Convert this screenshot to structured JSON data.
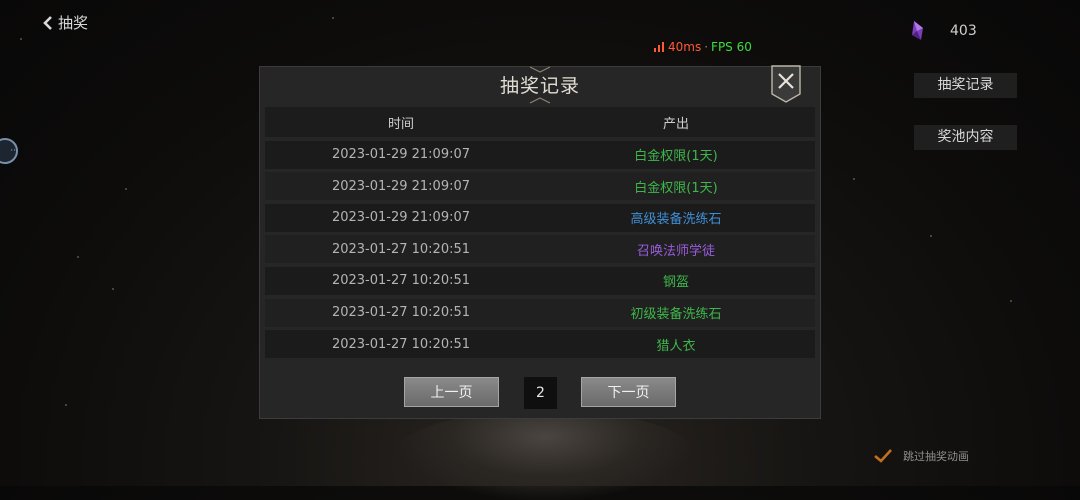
{
  "header": {
    "back_label": "抽奖"
  },
  "network": {
    "ping": "40ms",
    "separator": "·",
    "fps": "FPS 60"
  },
  "currency": {
    "icon": "purple-crystal-icon",
    "amount": "403"
  },
  "side_buttons": {
    "records": "抽奖记录",
    "pool": "奖池内容"
  },
  "modal": {
    "title": "抽奖记录",
    "columns": [
      "时间",
      "产出"
    ],
    "rows": [
      {
        "time": "2023-01-29 21:09:07",
        "item": "白金权限(1天)",
        "color": "#3fb64b"
      },
      {
        "time": "2023-01-29 21:09:07",
        "item": "白金权限(1天)",
        "color": "#3fb64b"
      },
      {
        "time": "2023-01-29 21:09:07",
        "item": "高级装备洗练石",
        "color": "#3f8fd6"
      },
      {
        "time": "2023-01-27 10:20:51",
        "item": "召唤法师学徒",
        "color": "#9a5cdc"
      },
      {
        "time": "2023-01-27 10:20:51",
        "item": "钢盔",
        "color": "#3fb64b"
      },
      {
        "time": "2023-01-27 10:20:51",
        "item": "初级装备洗练石",
        "color": "#3fb64b"
      },
      {
        "time": "2023-01-27 10:20:51",
        "item": "猎人衣",
        "color": "#3fb64b"
      }
    ],
    "pager": {
      "prev": "上一页",
      "page": "2",
      "next": "下一页"
    }
  },
  "skip_animation": {
    "label": "跳过抽奖动画",
    "checked": true
  }
}
